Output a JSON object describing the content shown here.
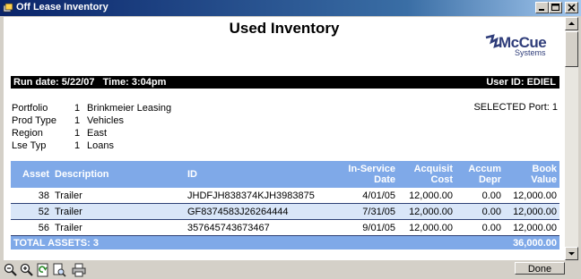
{
  "window": {
    "title": "Off Lease Inventory"
  },
  "report": {
    "title": "Used Inventory",
    "logo": {
      "name": "McCue",
      "tagline": "Systems"
    },
    "run_info": "Run date: 5/22/07   Time: 3:04pm",
    "user_info": "User ID: EDIEL",
    "selected_port": "SELECTED Port: 1"
  },
  "criteria": [
    {
      "label": "Portfolio",
      "num": "1",
      "value": "Brinkmeier Leasing"
    },
    {
      "label": "Prod Type",
      "num": "1",
      "value": "Vehicles"
    },
    {
      "label": "Region",
      "num": "1",
      "value": "East"
    },
    {
      "label": "Lse Typ",
      "num": "1",
      "value": "Loans"
    }
  ],
  "table": {
    "headers": {
      "asset": "Asset",
      "description": "Description",
      "id": "ID",
      "in_service_1": "In-Service",
      "in_service_2": "Date",
      "acquisit_1": "Acquisit",
      "acquisit_2": "Cost",
      "accum_1": "Accum",
      "accum_2": "Depr",
      "book_value": "Book Value"
    },
    "rows": [
      {
        "asset": "38",
        "description": "Trailer",
        "id": "JHDFJH838374KJH3983875",
        "date": "4/01/05",
        "cost": "12,000.00",
        "depr": "0.00",
        "book": "12,000.00"
      },
      {
        "asset": "52",
        "description": "Trailer",
        "id": "GF8374583J26264444",
        "date": "7/31/05",
        "cost": "12,000.00",
        "depr": "0.00",
        "book": "12,000.00"
      },
      {
        "asset": "56",
        "description": "Trailer",
        "id": "357645743673467",
        "date": "9/01/05",
        "cost": "12,000.00",
        "depr": "0.00",
        "book": "12,000.00"
      }
    ],
    "footer": {
      "label": "TOTAL ASSETS: 3",
      "total": "36,000.00"
    }
  },
  "toolbar": {
    "done_label": "Done"
  },
  "colors": {
    "header_bg": "#7fa9e8",
    "row_alt": "#d9e6f8",
    "titlebar": "#0a246a"
  }
}
